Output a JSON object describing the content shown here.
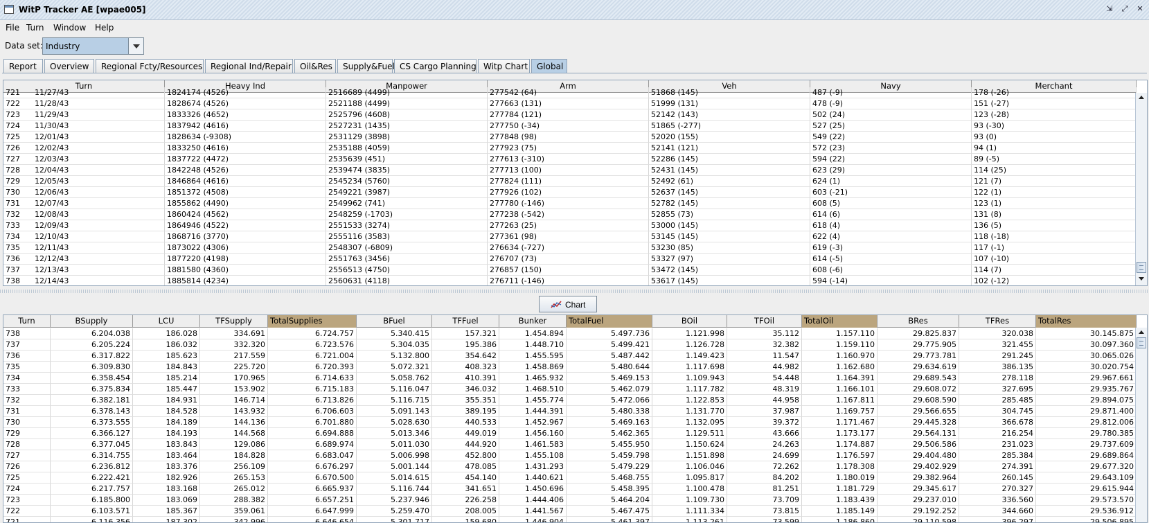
{
  "window": {
    "title": "WitP Tracker AE [wpae005]"
  },
  "menu": [
    "File",
    "Turn",
    "Window",
    "Help"
  ],
  "dataset": {
    "label": "Data set:",
    "value": "Industry"
  },
  "tabs": [
    "Report",
    "Overview",
    "Regional Fcty/Resources",
    "Regional Ind/Repair",
    "Oil&Res",
    "Supply&Fuel",
    "CS Cargo Planning",
    "Witp Chart",
    "Global"
  ],
  "active_tab": 8,
  "top_table": {
    "columns": [
      "Turn",
      "Heavy Ind",
      "Manpower",
      "Arm",
      "Veh",
      "Navy",
      "Merchant"
    ],
    "rows": [
      [
        "721",
        "11/27/43",
        "1824174 (4526)",
        "2516689 (4499)",
        "277542 (64)",
        "51868 (145)",
        "487 (-9)",
        "178 (-26)"
      ],
      [
        "722",
        "11/28/43",
        "1828674 (4526)",
        "2521188 (4499)",
        "277663 (131)",
        "51999 (131)",
        "478 (-9)",
        "151 (-27)"
      ],
      [
        "723",
        "11/29/43",
        "1833326 (4652)",
        "2525796 (4608)",
        "277784 (121)",
        "52142 (143)",
        "502 (24)",
        "123 (-28)"
      ],
      [
        "724",
        "11/30/43",
        "1837942 (4616)",
        "2527231 (1435)",
        "277750 (-34)",
        "51865 (-277)",
        "527 (25)",
        "93 (-30)"
      ],
      [
        "725",
        "12/01/43",
        "1828634 (-9308)",
        "2531129 (3898)",
        "277848 (98)",
        "52020 (155)",
        "549 (22)",
        "93 (0)"
      ],
      [
        "726",
        "12/02/43",
        "1833250 (4616)",
        "2535188 (4059)",
        "277923 (75)",
        "52141 (121)",
        "572 (23)",
        "94 (1)"
      ],
      [
        "727",
        "12/03/43",
        "1837722 (4472)",
        "2535639 (451)",
        "277613 (-310)",
        "52286 (145)",
        "594 (22)",
        "89 (-5)"
      ],
      [
        "728",
        "12/04/43",
        "1842248 (4526)",
        "2539474 (3835)",
        "277713 (100)",
        "52431 (145)",
        "623 (29)",
        "114 (25)"
      ],
      [
        "729",
        "12/05/43",
        "1846864 (4616)",
        "2545234 (5760)",
        "277824 (111)",
        "52492 (61)",
        "624 (1)",
        "121 (7)"
      ],
      [
        "730",
        "12/06/43",
        "1851372 (4508)",
        "2549221 (3987)",
        "277926 (102)",
        "52637 (145)",
        "603 (-21)",
        "122 (1)"
      ],
      [
        "731",
        "12/07/43",
        "1855862 (4490)",
        "2549962 (741)",
        "277780 (-146)",
        "52782 (145)",
        "608 (5)",
        "123 (1)"
      ],
      [
        "732",
        "12/08/43",
        "1860424 (4562)",
        "2548259 (-1703)",
        "277238 (-542)",
        "52855 (73)",
        "614 (6)",
        "131 (8)"
      ],
      [
        "733",
        "12/09/43",
        "1864946 (4522)",
        "2551533 (3274)",
        "277263 (25)",
        "53000 (145)",
        "618 (4)",
        "136 (5)"
      ],
      [
        "734",
        "12/10/43",
        "1868716 (3770)",
        "2555116 (3583)",
        "277361 (98)",
        "53145 (145)",
        "622 (4)",
        "118 (-18)"
      ],
      [
        "735",
        "12/11/43",
        "1873022 (4306)",
        "2548307 (-6809)",
        "276634 (-727)",
        "53230 (85)",
        "619 (-3)",
        "117 (-1)"
      ],
      [
        "736",
        "12/12/43",
        "1877220 (4198)",
        "2551763 (3456)",
        "276707 (73)",
        "53327 (97)",
        "614 (-5)",
        "107 (-10)"
      ],
      [
        "737",
        "12/13/43",
        "1881580 (4360)",
        "2556513 (4750)",
        "276857 (150)",
        "53472 (145)",
        "608 (-6)",
        "114 (7)"
      ],
      [
        "738",
        "12/14/43",
        "1885814 (4234)",
        "2560631 (4118)",
        "276711 (-146)",
        "53617 (145)",
        "594 (-14)",
        "102 (-12)"
      ]
    ]
  },
  "chart_button": {
    "label": "Chart"
  },
  "bottom_table": {
    "columns": [
      "Turn",
      "BSupply",
      "LCU",
      "TFSupply",
      "TotalSupplies",
      "BFuel",
      "TFFuel",
      "Bunker",
      "TotalFuel",
      "BOil",
      "TFOil",
      "TotalOil",
      "BRes",
      "TFRes",
      "TotalRes"
    ],
    "rows": [
      [
        "738",
        "6.204.038",
        "186.028",
        "334.691",
        "6.724.757",
        "5.340.415",
        "157.321",
        "1.454.894",
        "5.497.736",
        "1.121.998",
        "35.112",
        "1.157.110",
        "29.825.837",
        "320.038",
        "30.145.875"
      ],
      [
        "737",
        "6.205.224",
        "186.032",
        "332.320",
        "6.723.576",
        "5.304.035",
        "195.386",
        "1.448.710",
        "5.499.421",
        "1.126.728",
        "32.382",
        "1.159.110",
        "29.775.905",
        "321.455",
        "30.097.360"
      ],
      [
        "736",
        "6.317.822",
        "185.623",
        "217.559",
        "6.721.004",
        "5.132.800",
        "354.642",
        "1.455.595",
        "5.487.442",
        "1.149.423",
        "11.547",
        "1.160.970",
        "29.773.781",
        "291.245",
        "30.065.026"
      ],
      [
        "735",
        "6.309.830",
        "184.843",
        "225.720",
        "6.720.393",
        "5.072.321",
        "408.323",
        "1.458.869",
        "5.480.644",
        "1.117.698",
        "44.982",
        "1.162.680",
        "29.634.619",
        "386.135",
        "30.020.754"
      ],
      [
        "734",
        "6.358.454",
        "185.214",
        "170.965",
        "6.714.633",
        "5.058.762",
        "410.391",
        "1.465.932",
        "5.469.153",
        "1.109.943",
        "54.448",
        "1.164.391",
        "29.689.543",
        "278.118",
        "29.967.661"
      ],
      [
        "733",
        "6.375.834",
        "185.447",
        "153.902",
        "6.715.183",
        "5.116.047",
        "346.032",
        "1.468.510",
        "5.462.079",
        "1.117.782",
        "48.319",
        "1.166.101",
        "29.608.072",
        "327.695",
        "29.935.767"
      ],
      [
        "732",
        "6.382.181",
        "184.931",
        "146.714",
        "6.713.826",
        "5.116.715",
        "355.351",
        "1.455.774",
        "5.472.066",
        "1.122.853",
        "44.958",
        "1.167.811",
        "29.608.590",
        "285.485",
        "29.894.075"
      ],
      [
        "731",
        "6.378.143",
        "184.528",
        "143.932",
        "6.706.603",
        "5.091.143",
        "389.195",
        "1.444.391",
        "5.480.338",
        "1.131.770",
        "37.987",
        "1.169.757",
        "29.566.655",
        "304.745",
        "29.871.400"
      ],
      [
        "730",
        "6.373.555",
        "184.189",
        "144.136",
        "6.701.880",
        "5.028.630",
        "440.533",
        "1.452.967",
        "5.469.163",
        "1.132.095",
        "39.372",
        "1.171.467",
        "29.445.328",
        "366.678",
        "29.812.006"
      ],
      [
        "729",
        "6.366.127",
        "184.193",
        "144.568",
        "6.694.888",
        "5.013.346",
        "449.019",
        "1.456.160",
        "5.462.365",
        "1.129.511",
        "43.666",
        "1.173.177",
        "29.564.131",
        "216.254",
        "29.780.385"
      ],
      [
        "728",
        "6.377.045",
        "183.843",
        "129.086",
        "6.689.974",
        "5.011.030",
        "444.920",
        "1.461.583",
        "5.455.950",
        "1.150.624",
        "24.263",
        "1.174.887",
        "29.506.586",
        "231.023",
        "29.737.609"
      ],
      [
        "727",
        "6.314.755",
        "183.464",
        "184.828",
        "6.683.047",
        "5.006.998",
        "452.800",
        "1.455.108",
        "5.459.798",
        "1.151.898",
        "24.699",
        "1.176.597",
        "29.404.480",
        "285.384",
        "29.689.864"
      ],
      [
        "726",
        "6.236.812",
        "183.376",
        "256.109",
        "6.676.297",
        "5.001.144",
        "478.085",
        "1.431.293",
        "5.479.229",
        "1.106.046",
        "72.262",
        "1.178.308",
        "29.402.929",
        "274.391",
        "29.677.320"
      ],
      [
        "725",
        "6.222.421",
        "182.926",
        "265.153",
        "6.670.500",
        "5.014.615",
        "454.140",
        "1.440.621",
        "5.468.755",
        "1.095.817",
        "84.202",
        "1.180.019",
        "29.382.964",
        "260.145",
        "29.643.109"
      ],
      [
        "724",
        "6.217.757",
        "183.168",
        "265.012",
        "6.665.937",
        "5.116.744",
        "341.651",
        "1.450.696",
        "5.458.395",
        "1.100.478",
        "81.251",
        "1.181.729",
        "29.345.617",
        "270.327",
        "29.615.944"
      ],
      [
        "723",
        "6.185.800",
        "183.069",
        "288.382",
        "6.657.251",
        "5.237.946",
        "226.258",
        "1.444.406",
        "5.464.204",
        "1.109.730",
        "73.709",
        "1.183.439",
        "29.237.010",
        "336.560",
        "29.573.570"
      ],
      [
        "722",
        "6.103.571",
        "185.367",
        "359.061",
        "6.647.999",
        "5.259.470",
        "208.005",
        "1.441.567",
        "5.467.475",
        "1.111.334",
        "73.815",
        "1.185.149",
        "29.192.252",
        "344.660",
        "29.536.912"
      ],
      [
        "721",
        "6.116.356",
        "187.302",
        "342.996",
        "6.646.654",
        "5.301.717",
        "159.680",
        "1.446.904",
        "5.461.397",
        "1.113.261",
        "73.599",
        "1.186.860",
        "29.110.598",
        "396.297",
        "29.506.895"
      ]
    ]
  }
}
